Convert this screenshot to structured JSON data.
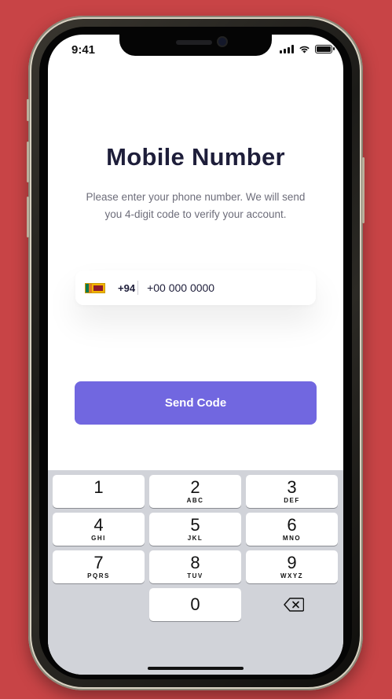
{
  "status_bar": {
    "time": "9:41"
  },
  "screen": {
    "title": "Mobile Number",
    "subtitle": "Please enter your phone number. We will send you 4-digit code to verify your account."
  },
  "phone_input": {
    "country_code": "+94",
    "country_flag": "sri-lanka-flag-icon",
    "value": "+00 000 0000"
  },
  "send_button": {
    "label": "Send Code"
  },
  "keypad": {
    "keys": [
      {
        "digit": "1",
        "letters": ""
      },
      {
        "digit": "2",
        "letters": "ABC"
      },
      {
        "digit": "3",
        "letters": "DEF"
      },
      {
        "digit": "4",
        "letters": "GHI"
      },
      {
        "digit": "5",
        "letters": "JKL"
      },
      {
        "digit": "6",
        "letters": "MNO"
      },
      {
        "digit": "7",
        "letters": "PQRS"
      },
      {
        "digit": "8",
        "letters": "TUV"
      },
      {
        "digit": "9",
        "letters": "WXYZ"
      },
      {
        "digit": "0",
        "letters": ""
      }
    ]
  },
  "colors": {
    "background": "#c84446",
    "accent": "#7167e0",
    "title": "#1e1e3a"
  }
}
